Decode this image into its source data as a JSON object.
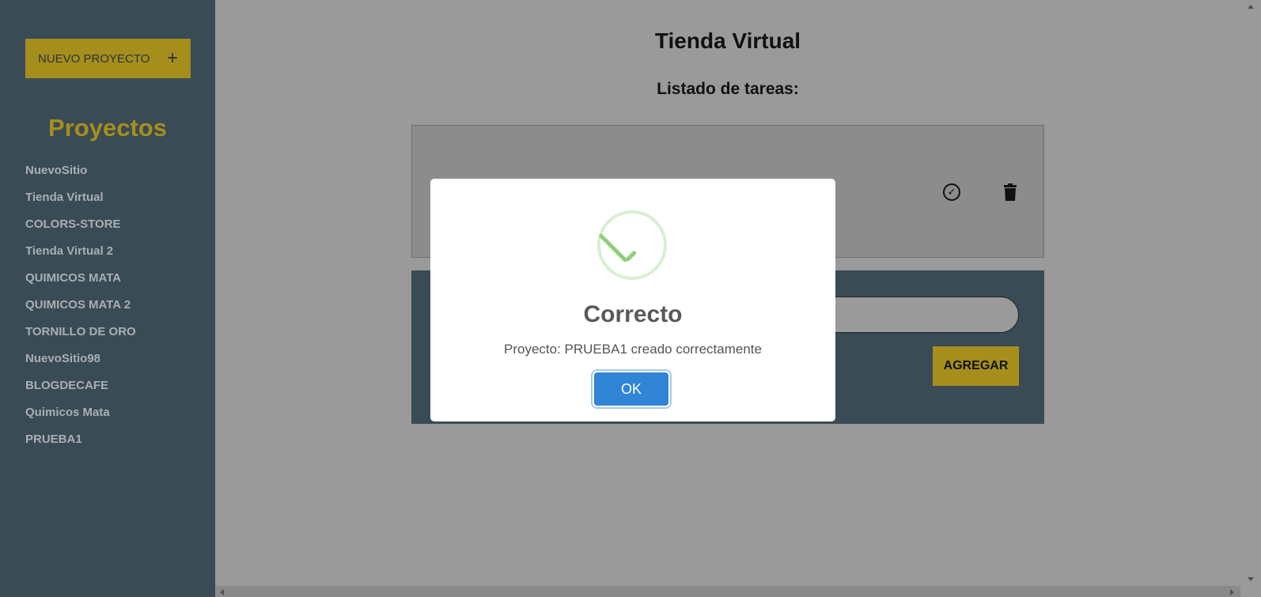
{
  "sidebar": {
    "new_project_label": "NUEVO PROYECTO",
    "new_project_icon": "+",
    "title": "Proyectos",
    "projects": [
      "NuevoSitio",
      "Tienda Virtual",
      "COLORS-STORE",
      "Tienda Virtual 2",
      "QUIMICOS MATA",
      "QUIMICOS MATA 2",
      "TORNILLO DE ORO",
      "NuevoSitio98",
      "BLOGDECAFE",
      "Quimicos Mata",
      "PRUEBA1"
    ]
  },
  "main": {
    "title": "Tienda Virtual",
    "task_heading": "Listado de tareas:",
    "add_button_label": "AGREGAR"
  },
  "modal": {
    "title": "Correcto",
    "message": "Proyecto: PRUEBA1 creado correctamente",
    "ok_label": "OK",
    "icon": "success-check-icon"
  },
  "colors": {
    "sidebar_bg": "#394b55",
    "accent": "#a68e1d",
    "overlay_bg": "#9a9a9a",
    "ok_button": "#3085d6",
    "success_check": "#8fd07a"
  }
}
